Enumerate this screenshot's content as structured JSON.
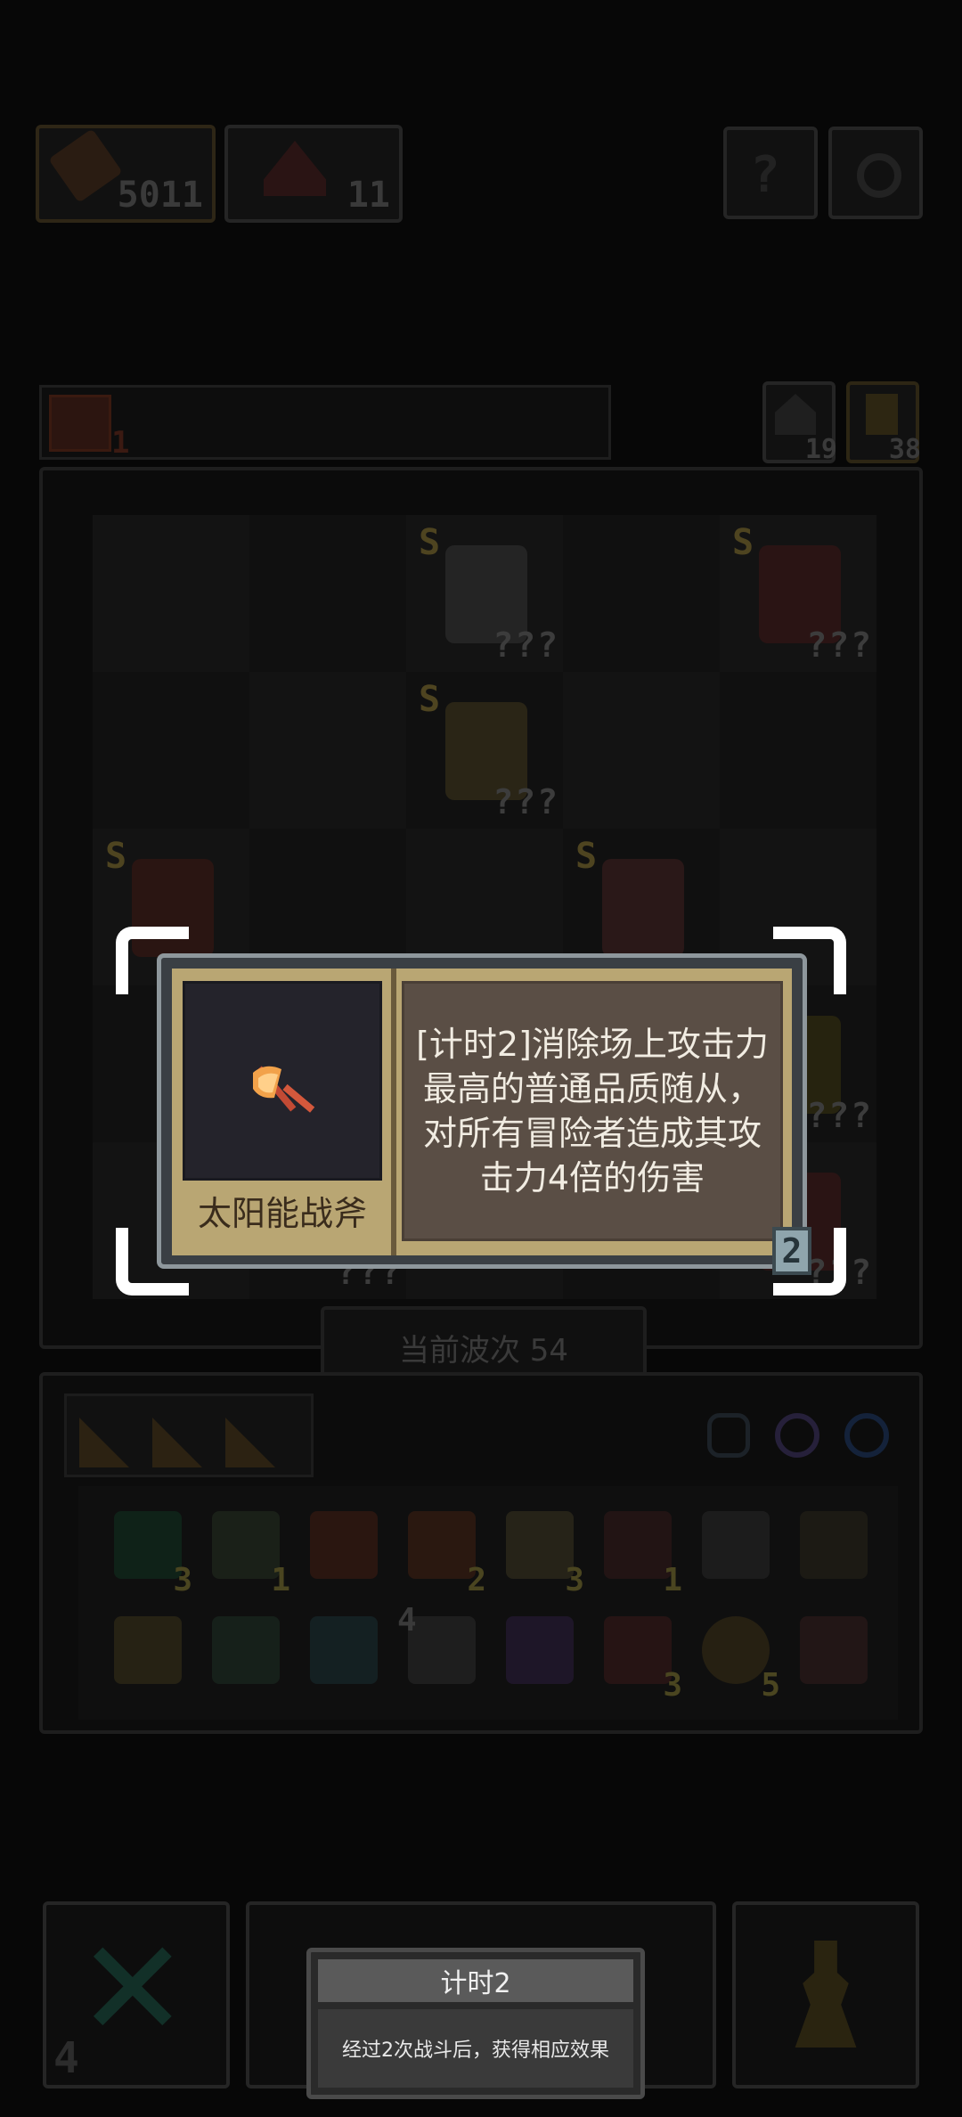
{
  "resources": {
    "gold": "5011",
    "gems": "11"
  },
  "status": {
    "health_badge": "1",
    "count_a": "19",
    "count_b": "38"
  },
  "board": {
    "heroes": [
      {
        "rank": "S",
        "level": "???"
      },
      {
        "rank": "S",
        "level": "???"
      },
      {
        "rank": "S",
        "level": "???"
      },
      {
        "rank": "S",
        "level": "???"
      },
      {
        "rank": "S",
        "level": "???"
      },
      {
        "rank": "",
        "level": "???"
      },
      {
        "rank": "",
        "level": "???"
      },
      {
        "rank": "",
        "level": "???"
      },
      {
        "rank": "",
        "level": "???"
      }
    ]
  },
  "wave": {
    "label": "当前波次 54"
  },
  "inventory": {
    "row1_counts": [
      "3",
      "1",
      "",
      "2",
      "3",
      "1",
      "",
      ""
    ],
    "row2_counts": [
      "",
      "",
      "",
      "4",
      "",
      "3",
      "5",
      ""
    ]
  },
  "popup": {
    "item_name": "太阳能战斧",
    "description": "[计时2]消除场上攻击力最高的普通品质随从，对所有冒险者造成其攻击力4倍的伤害",
    "timer_badge": "2"
  },
  "bottom": {
    "counter": "4"
  },
  "tooltip": {
    "title": "计时2",
    "body": "经过2次战斗后，获得相应效果"
  },
  "colors": {
    "popup_border": "#b9a673",
    "popup_desc_bg": "#5a4e45",
    "popup_icon_bg": "#24232b",
    "bracket": "#ffffff",
    "badge": "#8fa5ad"
  }
}
